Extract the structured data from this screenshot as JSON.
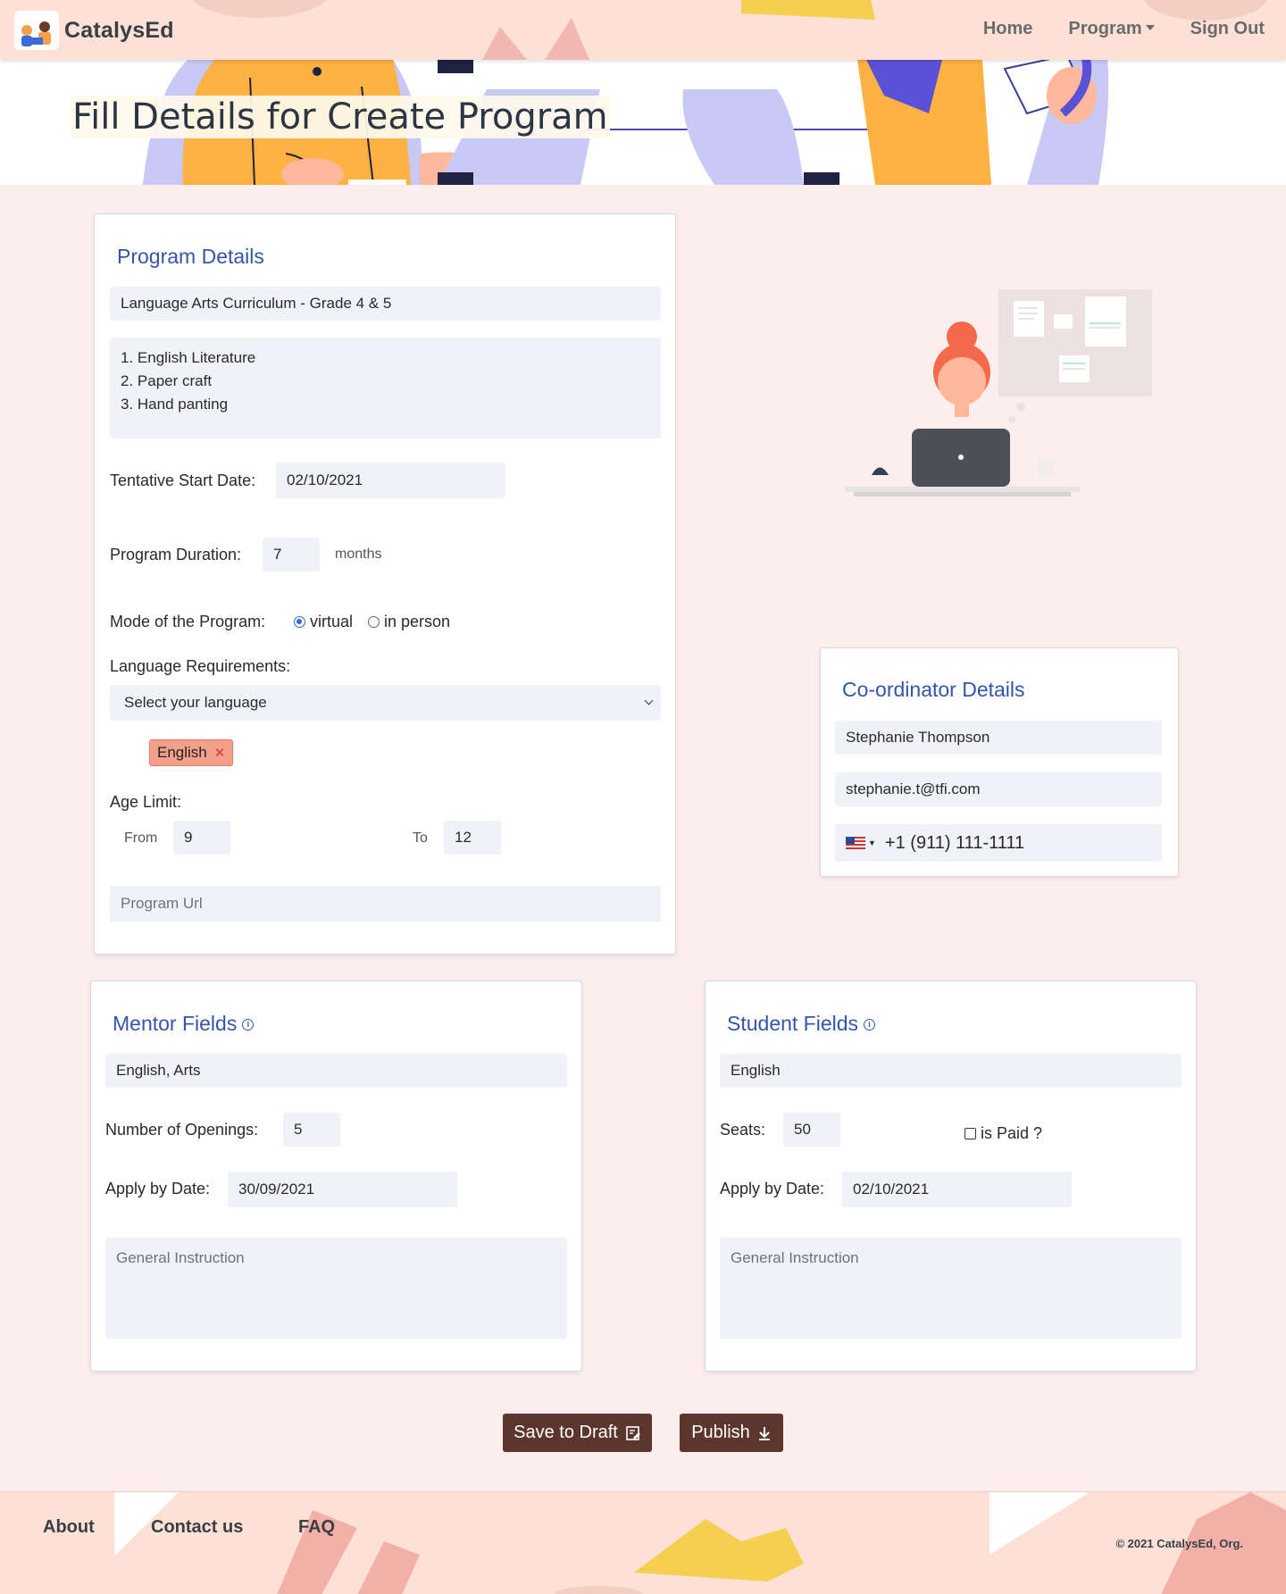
{
  "nav": {
    "brand": "CatalysEd",
    "links": [
      "Home",
      "Program",
      "Sign Out"
    ]
  },
  "hero": {
    "title": "Fill Details for Create Program"
  },
  "program": {
    "title": "Program Details",
    "name": "Language Arts Curriculum - Grade 4 & 5",
    "description": "1. English Literature\n2. Paper craft\n3. Hand panting",
    "start_label": "Tentative Start Date:",
    "start_value": "02/10/2021",
    "duration_label": "Program Duration:",
    "duration_value": "7",
    "duration_unit": "months",
    "mode_label": "Mode of the Program:",
    "mode_options": [
      "virtual",
      "in person"
    ],
    "mode_selected": "virtual",
    "language_label": "Language Requirements:",
    "language_select": "Select your language",
    "language_tag": "English",
    "age_label": "Age Limit:",
    "age_from_label": "From",
    "age_from": "9",
    "age_to_label": "To",
    "age_to": "12",
    "url_placeholder": "Program Url"
  },
  "coordinator": {
    "title": "Co-ordinator Details",
    "name": "Stephanie Thompson",
    "email": "stephanie.t@tfi.com",
    "phone": "+1 (911) 111-1111"
  },
  "mentor": {
    "title": "Mentor Fields",
    "subjects": "English, Arts",
    "openings_label": "Number of Openings:",
    "openings": "5",
    "apply_label": "Apply by Date:",
    "apply_date": "30/09/2021",
    "instruction_placeholder": "General Instruction"
  },
  "student": {
    "title": "Student Fields",
    "subjects": "English",
    "seats_label": "Seats:",
    "seats": "50",
    "paid_label": "is Paid ?",
    "paid": false,
    "apply_label": "Apply by Date:",
    "apply_date": "02/10/2021",
    "instruction_placeholder": "General Instruction"
  },
  "actions": {
    "save": "Save to Draft",
    "publish": "Publish"
  },
  "footer": {
    "links": [
      "About",
      "Contact us",
      "FAQ"
    ],
    "copyright": "© 2021 CatalysEd, Org."
  },
  "colors": {
    "accent": "#3355aa",
    "button": "#5c362c",
    "nav_bg": "#fde0d6",
    "page_bg": "#fdeeee",
    "tag_bg": "#f2a08a"
  },
  "icons": {
    "info": "info-icon",
    "save": "edit-note-icon",
    "publish": "download-icon",
    "flag": "us-flag-icon",
    "select": "chevron-down-icon",
    "remove": "close-icon"
  }
}
